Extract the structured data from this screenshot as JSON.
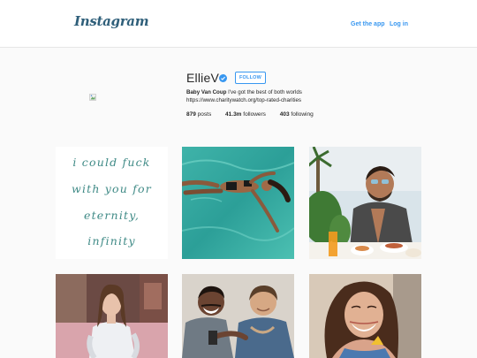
{
  "header": {
    "logo_text": "Instagram",
    "get_app_label": "Get the app",
    "login_label": "Log in"
  },
  "profile": {
    "username": "EllieV",
    "verified": true,
    "follow_label": "FOLLOW",
    "full_name": "Baby Van Coup",
    "bio": "I've got the best of both worlds",
    "link": "https://www.charitywatch.org/top-rated-charities",
    "stats": {
      "posts_count": "879",
      "posts_label": "posts",
      "followers_count": "41.3m",
      "followers_label": "followers",
      "following_count": "403",
      "following_label": "following"
    }
  },
  "posts": [
    {
      "kind": "quote",
      "lines": [
        "i could fuck",
        "with you for",
        "eternity,",
        "infinity"
      ]
    },
    {
      "kind": "photo",
      "subject": "woman-floating-in-pool"
    },
    {
      "kind": "photo",
      "subject": "man-in-robe-at-breakfast"
    },
    {
      "kind": "photo",
      "subject": "woman-in-pink-room"
    },
    {
      "kind": "photo",
      "subject": "two-men-posing"
    },
    {
      "kind": "photo",
      "subject": "smiling-woman"
    }
  ],
  "colors": {
    "accent": "#3897f0",
    "logo": "#2f5f7a",
    "quote_text": "#3f8a86",
    "background": "#fafafa"
  }
}
